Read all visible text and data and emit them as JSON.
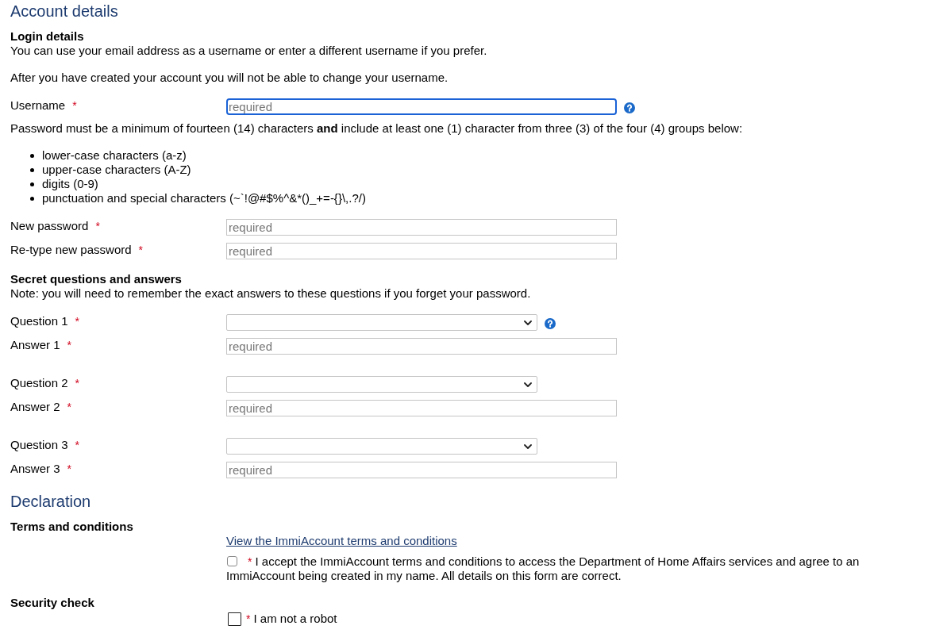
{
  "account_details": {
    "title": "Account details",
    "login_details": {
      "heading": "Login details",
      "paragraphs": [
        "You can use your email address as a username or enter a different username if you prefer.",
        "After you have created your account you will not be able to change your username."
      ]
    },
    "username": {
      "label": "Username",
      "required_mark": "*",
      "placeholder": "required",
      "focused": true,
      "help": true
    },
    "password_rule": "Password must be a minimum of fourteen (14) characters **and** include at least one (1) character from three (3) of the four (4) groups below:",
    "password_groups": [
      "lower-case characters (a-z)",
      "upper-case characters (A-Z)",
      "digits (0-9)",
      "punctuation and special characters (~`!@#$%^&*()_+=-{}\\,.?/)"
    ],
    "password_fields": [
      {
        "label": "New password",
        "required_mark": "*",
        "placeholder": "required",
        "focused": false,
        "help": false
      },
      {
        "label": "Re-type new password",
        "required_mark": "*",
        "placeholder": "required",
        "focused": false,
        "help": false
      }
    ],
    "secret_questions": {
      "heading": "Secret questions and answers",
      "note": "Note: you will need to remember the exact answers to these questions if you forget your password.",
      "pairs": [
        {
          "question": {
            "label": "Question 1",
            "required_mark": "*",
            "focused": false,
            "help": true
          },
          "answer": {
            "label": "Answer 1",
            "required_mark": "*",
            "placeholder": "required",
            "focused": false,
            "help": false
          }
        },
        {
          "question": {
            "label": "Question 2",
            "required_mark": "*",
            "focused": false,
            "help": false
          },
          "answer": {
            "label": "Answer 2",
            "required_mark": "*",
            "placeholder": "required",
            "focused": false,
            "help": false
          }
        },
        {
          "question": {
            "label": "Question 3",
            "required_mark": "*",
            "focused": false,
            "help": false
          },
          "answer": {
            "label": "Answer 3",
            "required_mark": "*",
            "placeholder": "required",
            "focused": false,
            "help": false
          }
        }
      ]
    }
  },
  "declaration": {
    "title": "Declaration",
    "terms": {
      "heading": "Terms and conditions",
      "link": "View the ImmiAccount terms and conditions",
      "checkbox": {
        "checked": false,
        "required_mark": "*",
        "label": "I accept the ImmiAccount terms and conditions to access the Department of Home Affairs services and agree to an ImmiAccount being created in my name. All details on this form are correct."
      }
    },
    "security_check": {
      "heading": "Security check",
      "checkbox": {
        "checked": false,
        "required_mark": "*",
        "label": "I am not a robot"
      }
    }
  }
}
